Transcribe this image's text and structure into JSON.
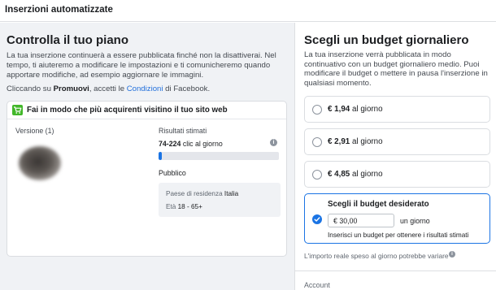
{
  "dialog": {
    "title": "Inserzioni automatizzate"
  },
  "left": {
    "heading": "Controlla il tuo piano",
    "description": "La tua inserzione continuerà a essere pubblicata finché non la disattiverai. Nel tempo, ti aiuteremo a modificare le impostazioni e ti comunicheremo quando apportare modifiche, ad esempio aggiornare le immagini.",
    "terms": {
      "prefix": "Cliccando su ",
      "bold": "Promuovi",
      "middle": ", accetti le ",
      "link": "Condizioni",
      "suffix": " di Facebook."
    },
    "card": {
      "goal": "Fai in modo che più acquirenti visitino il tuo sito web",
      "version_label": "Versione (1)",
      "results_label": "Risultati stimati",
      "results_range": "74-224",
      "results_unit": " clic al giorno",
      "results_progress": 0.03,
      "audience_label": "Pubblico",
      "residence_label": "Paese di residenza ",
      "residence_value": "Italia",
      "age_label": "Età ",
      "age_value": "18 - 65+"
    }
  },
  "right": {
    "heading": "Scegli un budget giornaliero",
    "description": "La tua inserzione verrà pubblicata in modo continuativo con un budget giornaliero medio. Puoi modificare il budget o mettere in pausa l'inserzione in qualsiasi momento.",
    "options": [
      {
        "amount": "€ 1,94",
        "suffix": " al giorno"
      },
      {
        "amount": "€ 2,91",
        "suffix": " al giorno"
      },
      {
        "amount": "€ 4,85",
        "suffix": " al giorno"
      }
    ],
    "custom": {
      "title": "Scegli il budget desiderato",
      "value": "€ 30,00",
      "unit": "un giorno",
      "hint": "Inserisci un budget per ottenere i risultati stimati"
    },
    "note": "L'importo reale speso al giorno potrebbe variare",
    "account_label": "Account"
  },
  "colors": {
    "accent": "#1b74e4",
    "goal_icon": "#42b72a",
    "panel_bg": "#f0f2f5"
  },
  "icons": {
    "goal": "shopping-cart-icon",
    "info": "info-icon",
    "selected": "check-icon"
  }
}
